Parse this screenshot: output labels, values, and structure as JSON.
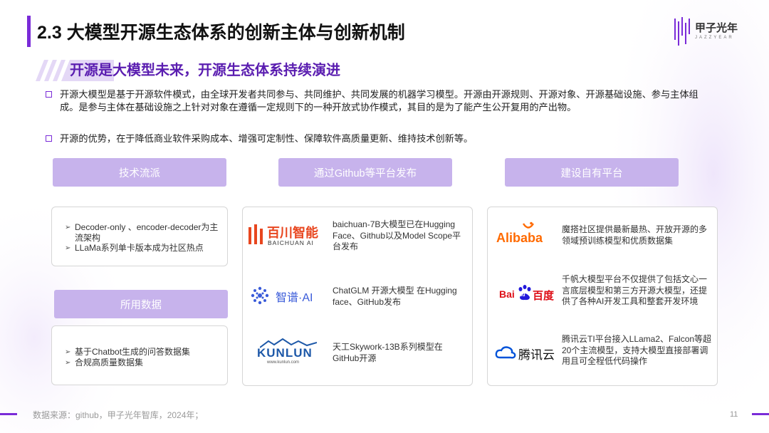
{
  "header": {
    "title": "2.3 大模型开源生态体系的创新主体与创新机制",
    "logo_name": "甲子光年",
    "logo_sub": "JAZZYEAR"
  },
  "subtitle": "开源是大模型未来，开源生态体系持续演进",
  "bullets": [
    "开源大模型是基于开源软件模式，由全球开发者共同参与、共同维护、共同发展的机器学习模型。开源由开源规则、开源对象、开源基础设施、参与主体组成。是参与主体在基础设施之上针对对象在遵循一定规则下的一种开放式协作模式，其目的是为了能产生公开复用的产出物。",
    "开源的优势，在于降低商业软件采购成本、增强可定制性、保障软件高质量更新、维持技术创新等。"
  ],
  "sections": {
    "tech": {
      "label": "技术流派",
      "items": [
        "Decoder-only 、encoder-decoder为主流架构",
        "LLaMa系列单卡版本成为社区热点"
      ]
    },
    "data": {
      "label": "所用数据",
      "items": [
        "基于Chatbot生成的问答数据集",
        "合规高质量数据集"
      ]
    },
    "github": {
      "label": "通过Github等平台发布",
      "entries": [
        {
          "logo": "百川智能",
          "logo_sub": "BAICHUAN AI",
          "text": "baichuan-7B大模型已在Hugging Face、Github以及Model Scope平台发布"
        },
        {
          "logo": "智谱·AI",
          "text": "ChatGLM 开源大模型 在Hugging face、GitHub发布"
        },
        {
          "logo": "KUNLUN",
          "logo_sub": "www.kunlun.com",
          "text": "天工Skywork-13B系列模型在GitHub开源"
        }
      ]
    },
    "platform": {
      "label": "建设自有平台",
      "entries": [
        {
          "logo": "Alibaba",
          "text": "魔搭社区提供最新最热、开放开源的多领域预训练模型和优质数据集"
        },
        {
          "logo_a": "Bai",
          "logo_b": "du",
          "logo_c": "百度",
          "text": "千帆大模型平台不仅提供了包括文心一言底层模型和第三方开源大模型，还提供了各种AI开发工具和整套开发环境"
        },
        {
          "logo": "腾讯云",
          "text": "腾讯云TI平台接入LLama2、Falcon等超20个主流模型，支持大模型直接部署调用且可全程低代码操作"
        }
      ]
    }
  },
  "footer": {
    "source": "数据来源：github，甲子光年智库，2024年；",
    "page": "11"
  },
  "colors": {
    "accent": "#7a2bd8",
    "subtitle": "#5a1db0",
    "pill": "#c7b3ec",
    "alibaba": "#ff6a00",
    "baidu_red": "#de0f17",
    "baidu_blue": "#2319dc",
    "tencent": "#0052d9",
    "baichuan": "#e8461f",
    "zhipu": "#3a5bd9",
    "kunlun": "#1d58a8"
  },
  "icons": [
    "alibaba-smile-icon",
    "baidu-paw-icon",
    "tencent-cloud-icon",
    "zhipu-dots-icon",
    "kunlun-mountain-icon",
    "logo-bars-icon"
  ]
}
